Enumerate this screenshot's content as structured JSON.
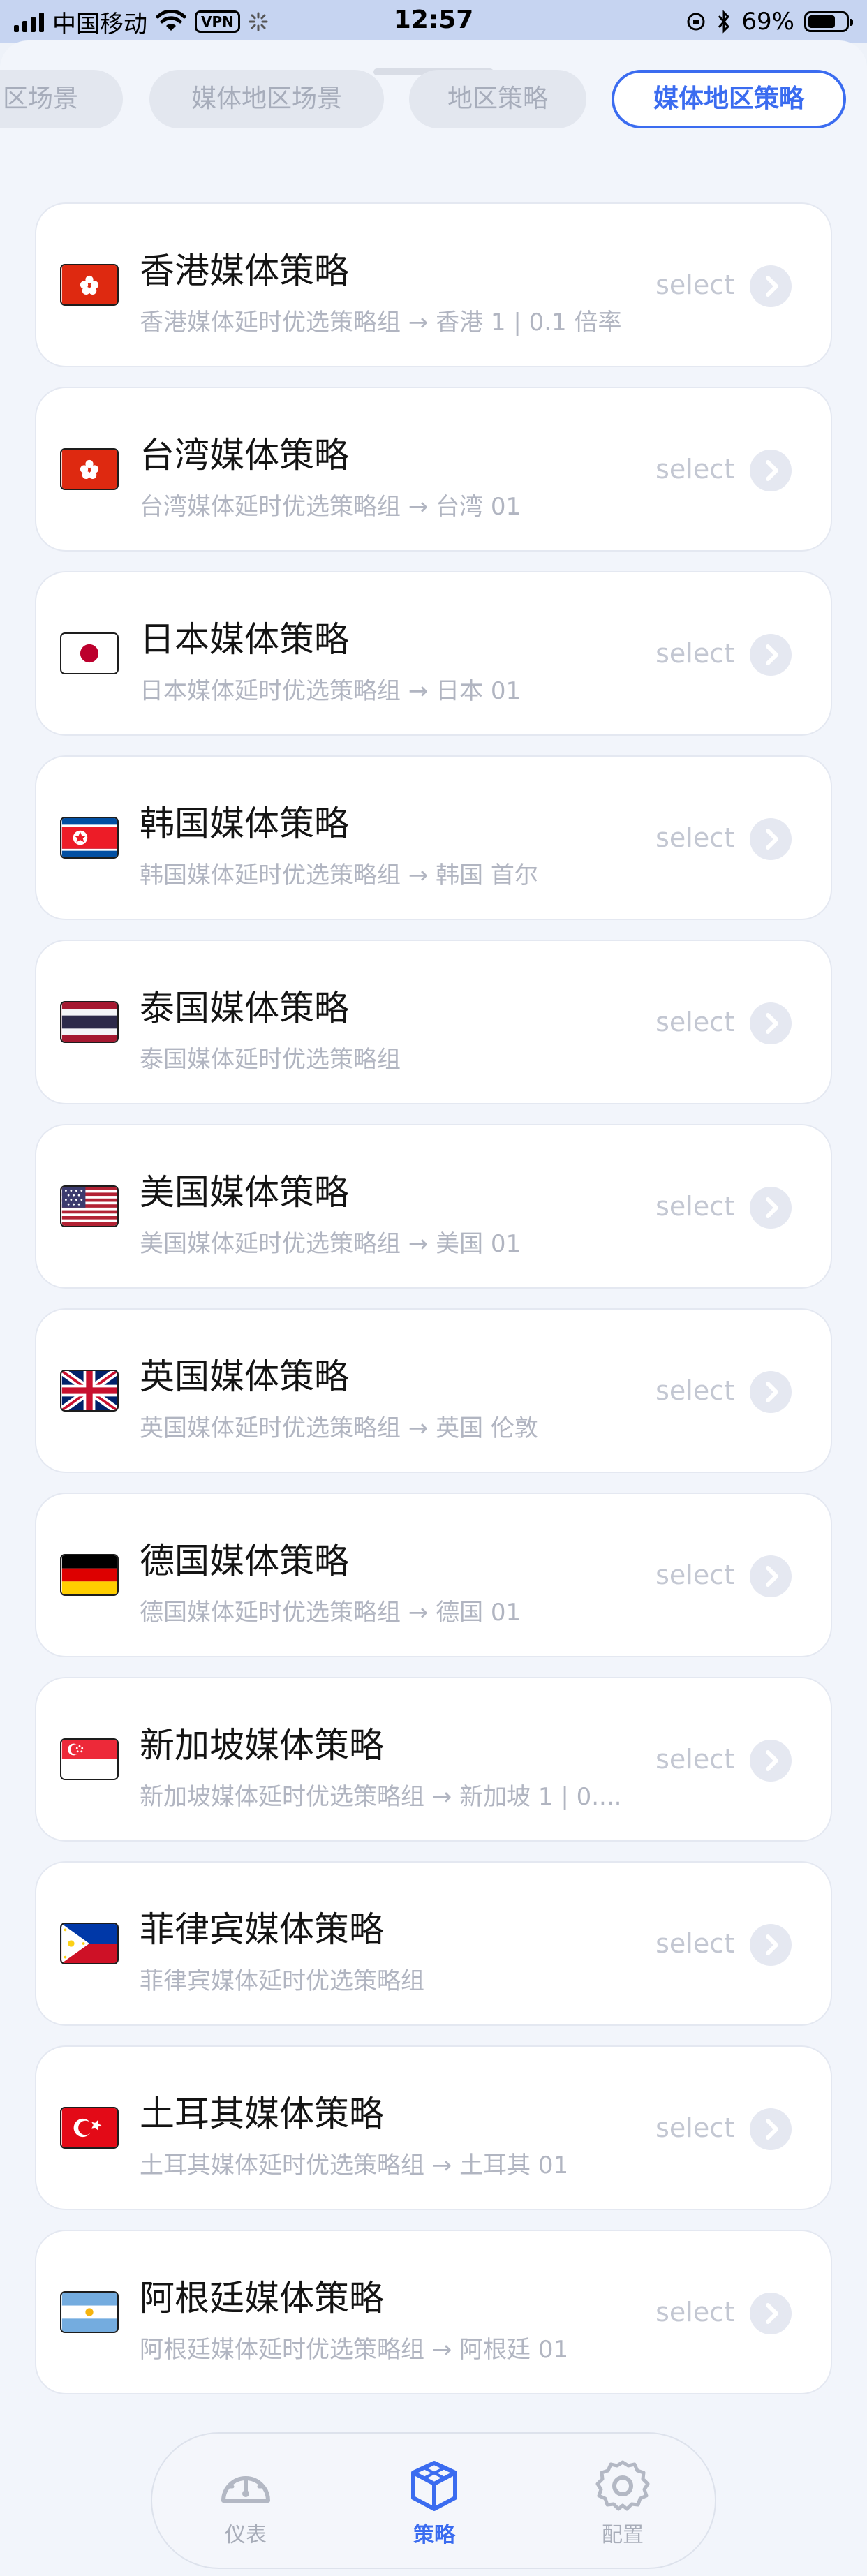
{
  "status_bar": {
    "carrier": "中国移动",
    "vpn": "VPN",
    "time": "12:57",
    "battery": "69%"
  },
  "tabs": [
    {
      "label": "区场景",
      "active": false
    },
    {
      "label": "媒体地区场景",
      "active": false
    },
    {
      "label": "地区策略",
      "active": false
    },
    {
      "label": "媒体地区策略",
      "active": true
    }
  ],
  "select_label": "select",
  "items": [
    {
      "flag": "hong-kong",
      "title": "香港媒体策略",
      "subtitle": "香港媒体延时优选策略组 → 香港 1 | 0.1 倍率"
    },
    {
      "flag": "hong-kong",
      "title": "台湾媒体策略",
      "subtitle": "台湾媒体延时优选策略组 → 台湾 01"
    },
    {
      "flag": "japan",
      "title": "日本媒体策略",
      "subtitle": "日本媒体延时优选策略组 → 日本 01"
    },
    {
      "flag": "north-korea",
      "title": "韩国媒体策略",
      "subtitle": "韩国媒体延时优选策略组 → 韩国 首尔"
    },
    {
      "flag": "thailand",
      "title": "泰国媒体策略",
      "subtitle": "泰国媒体延时优选策略组"
    },
    {
      "flag": "usa",
      "title": "美国媒体策略",
      "subtitle": "美国媒体延时优选策略组 → 美国 01"
    },
    {
      "flag": "uk",
      "title": "英国媒体策略",
      "subtitle": "英国媒体延时优选策略组 → 英国 伦敦"
    },
    {
      "flag": "germany",
      "title": "德国媒体策略",
      "subtitle": "德国媒体延时优选策略组 → 德国 01"
    },
    {
      "flag": "singapore",
      "title": "新加坡媒体策略",
      "subtitle": "新加坡媒体延时优选策略组 → 新加坡 1 | 0...."
    },
    {
      "flag": "philippines",
      "title": "菲律宾媒体策略",
      "subtitle": "菲律宾媒体延时优选策略组"
    },
    {
      "flag": "turkey",
      "title": "土耳其媒体策略",
      "subtitle": "土耳其媒体延时优选策略组 → 土耳其 01"
    },
    {
      "flag": "argentina",
      "title": "阿根廷媒体策略",
      "subtitle": "阿根廷媒体延时优选策略组 → 阿根廷 01"
    }
  ],
  "bottom_nav": [
    {
      "label": "仪表",
      "icon": "dashboard-icon",
      "active": false
    },
    {
      "label": "策略",
      "icon": "cube-icon",
      "active": true
    },
    {
      "label": "配置",
      "icon": "gear-icon",
      "active": false
    }
  ],
  "colors": {
    "accent": "#3b6cf0",
    "muted": "#b1b5c1",
    "background": "#f2f5fb"
  }
}
